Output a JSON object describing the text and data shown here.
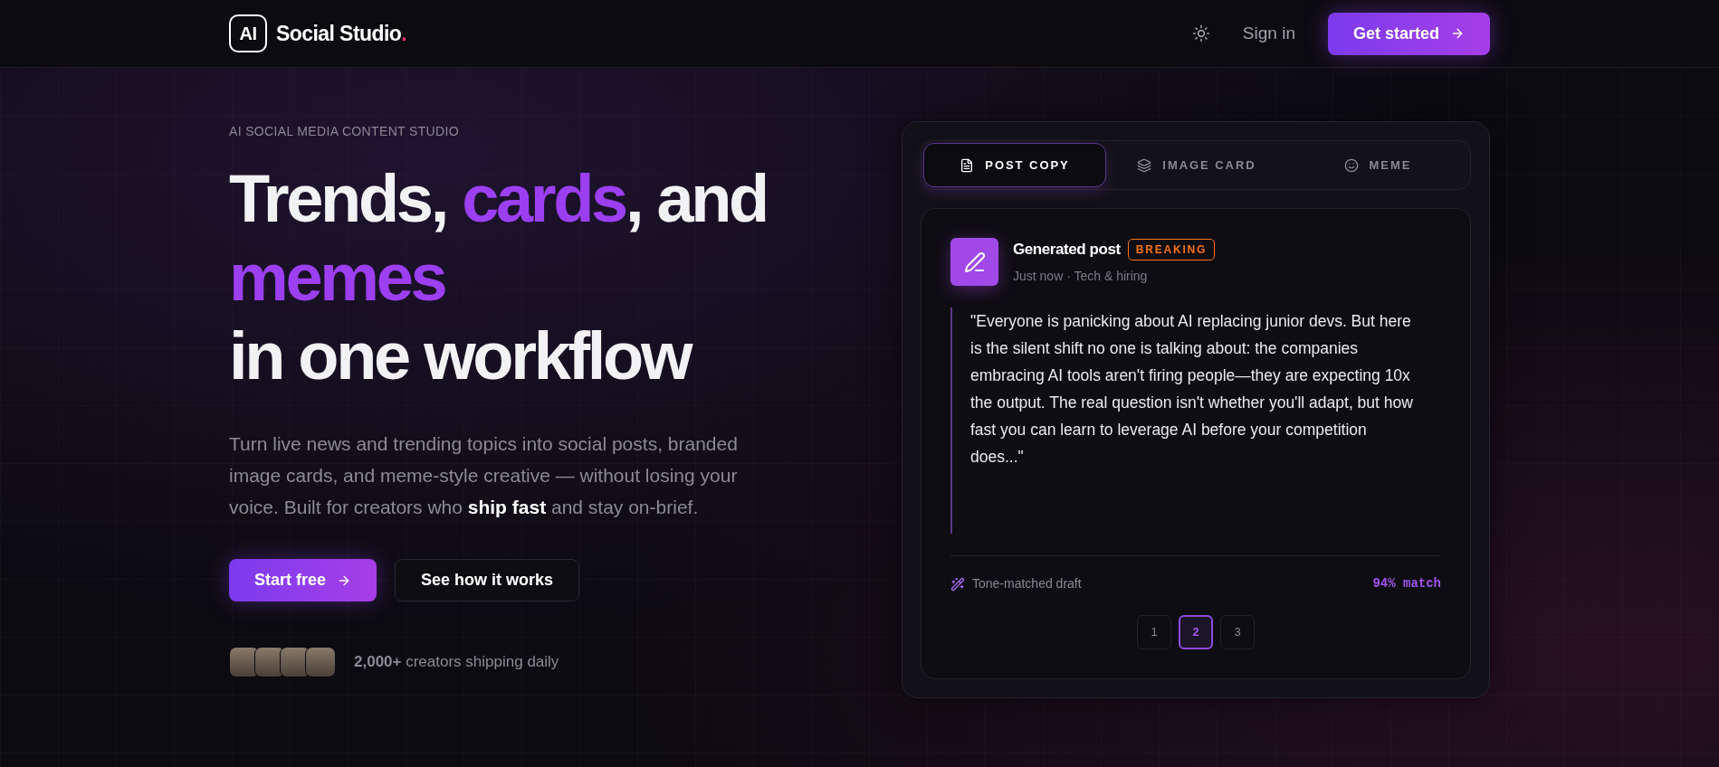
{
  "header": {
    "logo_mark": "AI",
    "logo_text": "Social Studio",
    "logo_dot": ".",
    "sign_in": "Sign in",
    "cta": "Get started"
  },
  "hero": {
    "eyebrow": "AI SOCIAL MEDIA CONTENT STUDIO",
    "headline": [
      [
        {
          "text": "Trends, ",
          "accent": false
        },
        {
          "text": "cards",
          "accent": true
        },
        {
          "text": ", and",
          "accent": false
        }
      ],
      [
        {
          "text": "memes",
          "accent": true
        }
      ],
      [
        {
          "text": "in one workflow",
          "accent": false
        }
      ]
    ],
    "description": "Turn live news and trending topics into social posts, branded image cards, and meme-style creative — without losing your voice. Built for creators who **ship fast** and stay on-brief.",
    "primary_button": "Start free",
    "secondary_button": "See how it works",
    "social_proof": "**2,000+** creators shipping daily"
  },
  "preview": {
    "tabs": [
      {
        "label": "POST COPY",
        "kind": "post",
        "selected": true
      },
      {
        "label": "IMAGE CARD",
        "kind": "image",
        "selected": false
      },
      {
        "label": "MEME",
        "kind": "meme",
        "selected": false
      }
    ],
    "post": {
      "title": "Generated post",
      "badge": {
        "label": "BREAKING",
        "color": "#f97316"
      },
      "meta": "Just now · Tech & hiring",
      "body": "\"Everyone is panicking about AI replacing junior devs. But here is the silent shift no one is talking about: the companies embracing AI tools aren't firing people—they are expecting 10x the output. The real question isn't whether you'll adapt, but how fast you can learn to leverage AI before your competition does...\"",
      "footer_label": "Tone-matched draft",
      "match": "94% match"
    },
    "pages": [
      {
        "label": "1",
        "selected": false
      },
      {
        "label": "2",
        "selected": true
      },
      {
        "label": "3",
        "selected": false
      }
    ]
  }
}
